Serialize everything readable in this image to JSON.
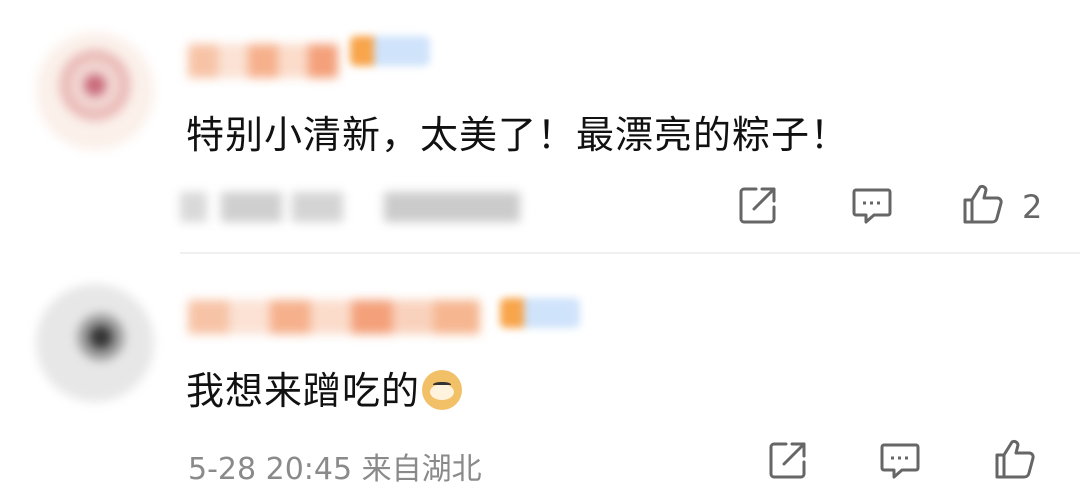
{
  "comments": [
    {
      "text": "特别小清新，太美了！最漂亮的粽子！",
      "time_location": "",
      "like_count": "2",
      "icons": {
        "share": "share-icon",
        "reply": "comment-icon",
        "like": "thumbs-up-icon"
      }
    },
    {
      "text": "我想来蹭吃的",
      "emoji": "doge-emoji",
      "time_location": "5-28 20:45 来自湖北",
      "like_count": "",
      "icons": {
        "share": "share-icon",
        "reply": "comment-icon",
        "like": "thumbs-up-icon"
      }
    }
  ],
  "colors": {
    "text": "#111111",
    "meta": "#8a8a8a",
    "icon": "#666666",
    "divider": "#f0f0f0"
  }
}
